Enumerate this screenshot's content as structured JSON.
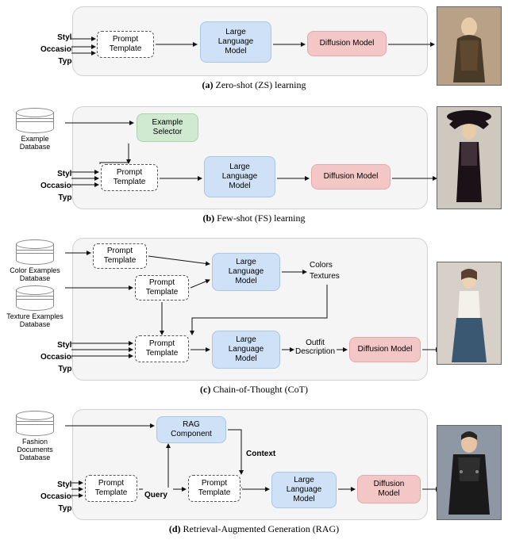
{
  "inputs": {
    "style": "Style",
    "occasion": "Occasion",
    "type": "Type"
  },
  "blocks": {
    "prompt_template": "Prompt\nTemplate",
    "llm": "Large\nLanguage\nModel",
    "diffusion": "Diffusion Model",
    "diffusion2": "Diffusion\nModel",
    "example_selector": "Example\nSelector",
    "rag_component": "RAG\nComponent"
  },
  "databases": {
    "example": "Example\nDatabase",
    "color": "Color Examples\nDatabase",
    "texture": "Texture Examples\nDatabase",
    "fashion": "Fashion\nDocuments\nDatabase"
  },
  "flow_labels": {
    "colors": "Colors",
    "textures": "Textures",
    "outfit_desc": "Outfit\nDescription",
    "context": "Context",
    "query": "Query"
  },
  "captions": {
    "a": {
      "tag": "(a)",
      "text": "Zero-shot (ZS) learning"
    },
    "b": {
      "tag": "(b)",
      "text": "Few-shot (FS) learning"
    },
    "c": {
      "tag": "(c)",
      "text": "Chain-of-Thought (CoT)"
    },
    "d": {
      "tag": "(d)",
      "text": "Retrieval-Augmented Generation (RAG)"
    }
  },
  "chart_data": {
    "type": "diagram",
    "subfigures": [
      {
        "id": "a",
        "title": "Zero-shot (ZS) learning",
        "inputs": [
          "Style",
          "Occasion",
          "Type"
        ],
        "nodes": [
          "Prompt Template",
          "Large Language Model",
          "Diffusion Model"
        ],
        "edges": [
          [
            "Style",
            "Prompt Template"
          ],
          [
            "Occasion",
            "Prompt Template"
          ],
          [
            "Type",
            "Prompt Template"
          ],
          [
            "Prompt Template",
            "Large Language Model"
          ],
          [
            "Large Language Model",
            "Diffusion Model"
          ],
          [
            "Diffusion Model",
            "Output Image"
          ]
        ]
      },
      {
        "id": "b",
        "title": "Few-shot (FS) learning",
        "inputs": [
          "Style",
          "Occasion",
          "Type"
        ],
        "databases": [
          "Example Database"
        ],
        "nodes": [
          "Example Selector",
          "Prompt Template",
          "Large Language Model",
          "Diffusion Model"
        ],
        "edges": [
          [
            "Example Database",
            "Example Selector"
          ],
          [
            "Example Selector",
            "Prompt Template"
          ],
          [
            "Style",
            "Prompt Template"
          ],
          [
            "Occasion",
            "Prompt Template"
          ],
          [
            "Type",
            "Prompt Template"
          ],
          [
            "Prompt Template",
            "Large Language Model"
          ],
          [
            "Large Language Model",
            "Diffusion Model"
          ],
          [
            "Diffusion Model",
            "Output Image"
          ]
        ]
      },
      {
        "id": "c",
        "title": "Chain-of-Thought (CoT)",
        "inputs": [
          "Style",
          "Occasion",
          "Type"
        ],
        "databases": [
          "Color Examples Database",
          "Texture Examples Database"
        ],
        "nodes": [
          "Prompt Template (colors)",
          "Prompt Template (textures)",
          "Large Language Model (1)",
          "Prompt Template (outfit)",
          "Large Language Model (2)",
          "Diffusion Model"
        ],
        "intermediate_labels": [
          "Colors",
          "Textures",
          "Outfit Description"
        ],
        "edges": [
          [
            "Color Examples Database",
            "Prompt Template (colors)"
          ],
          [
            "Texture Examples Database",
            "Prompt Template (textures)"
          ],
          [
            "Prompt Template (colors)",
            "Large Language Model (1)"
          ],
          [
            "Prompt Template (textures)",
            "Large Language Model (1)"
          ],
          [
            "Large Language Model (1)",
            "Colors/Textures"
          ],
          [
            "Style",
            "Prompt Template (outfit)"
          ],
          [
            "Occasion",
            "Prompt Template (outfit)"
          ],
          [
            "Type",
            "Prompt Template (outfit)"
          ],
          [
            "Colors/Textures",
            "Prompt Template (outfit)"
          ],
          [
            "Prompt Template (outfit)",
            "Large Language Model (2)"
          ],
          [
            "Large Language Model (2)",
            "Outfit Description"
          ],
          [
            "Outfit Description",
            "Diffusion Model"
          ],
          [
            "Diffusion Model",
            "Output Image"
          ]
        ]
      },
      {
        "id": "d",
        "title": "Retrieval-Augmented Generation (RAG)",
        "inputs": [
          "Style",
          "Occasion",
          "Type"
        ],
        "databases": [
          "Fashion Documents Database"
        ],
        "nodes": [
          "Prompt Template (query)",
          "RAG Component",
          "Prompt Template (final)",
          "Large Language Model",
          "Diffusion Model"
        ],
        "intermediate_labels": [
          "Query",
          "Context"
        ],
        "edges": [
          [
            "Fashion Documents Database",
            "RAG Component"
          ],
          [
            "Style",
            "Prompt Template (query)"
          ],
          [
            "Occasion",
            "Prompt Template (query)"
          ],
          [
            "Type",
            "Prompt Template (query)"
          ],
          [
            "Prompt Template (query)",
            "Query"
          ],
          [
            "Query",
            "RAG Component"
          ],
          [
            "Query",
            "Prompt Template (final)"
          ],
          [
            "RAG Component",
            "Context"
          ],
          [
            "Context",
            "Prompt Template (final)"
          ],
          [
            "Prompt Template (final)",
            "Large Language Model"
          ],
          [
            "Large Language Model",
            "Diffusion Model"
          ],
          [
            "Diffusion Model",
            "Output Image"
          ]
        ]
      }
    ]
  }
}
